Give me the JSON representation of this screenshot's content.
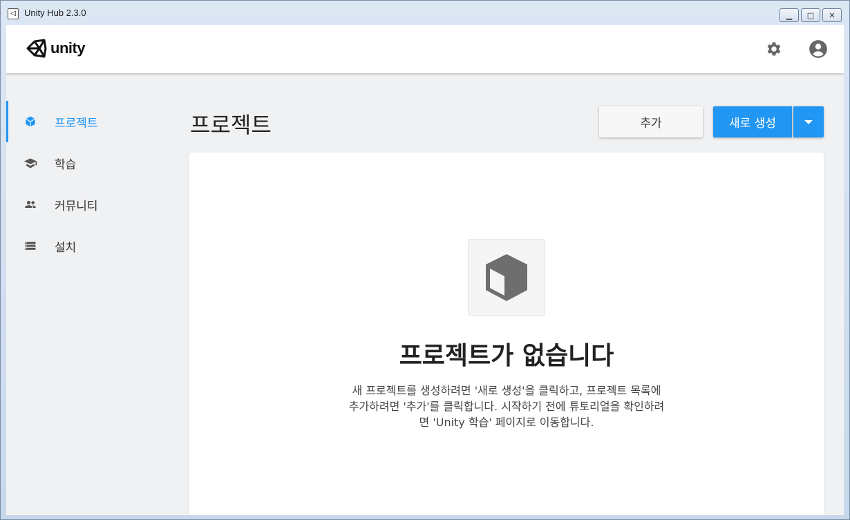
{
  "window": {
    "title": "Unity Hub 2.3.0",
    "controls": {
      "minimize": "▁",
      "maximize": "□",
      "close": "✕"
    }
  },
  "header": {
    "logo_text": "unity",
    "icons": [
      "gear-icon",
      "account-icon"
    ]
  },
  "sidebar": {
    "items": [
      {
        "label": "프로젝트",
        "icon": "cube-icon",
        "active": true
      },
      {
        "label": "학습",
        "icon": "graduation-cap-icon",
        "active": false
      },
      {
        "label": "커뮤니티",
        "icon": "people-icon",
        "active": false
      },
      {
        "label": "설치",
        "icon": "server-list-icon",
        "active": false
      }
    ]
  },
  "main": {
    "title": "프로젝트",
    "add_button": "추가",
    "new_button": "새로 생성",
    "empty_state": {
      "title": "프로젝트가 없습니다",
      "lines": [
        "새 프로젝트를 생성하려면 '새로 생성'을 클릭하고, 프로젝트 목록에",
        "추가하려면 '추가'를 클릭합니다. 시작하기 전에 튜토리얼을 확인하려",
        "면 'Unity 학습' 페이지로 이동합니다."
      ]
    }
  },
  "colors": {
    "accent": "#2196f3",
    "background": "#f0f1f3",
    "panel": "#ffffff"
  }
}
